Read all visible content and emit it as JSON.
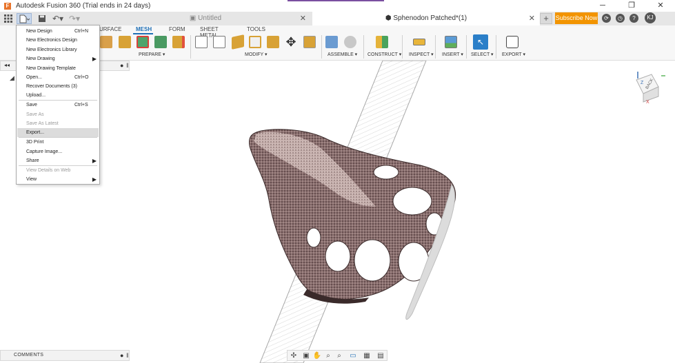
{
  "window": {
    "title": "Autodesk Fusion 360 (Trial ends in 24 days)",
    "minimize": "─",
    "maximize": "❐",
    "close": "✕"
  },
  "tabs": {
    "inactive": {
      "label": "Untitled",
      "close": "✕"
    },
    "active": {
      "label": "Sphenodon Patched*(1)",
      "close": "✕"
    },
    "new_tab": "+",
    "subscribe": "Subscribe Now",
    "user_initials": "KJ"
  },
  "ribbon": {
    "workspace_tabs": [
      "URFACE",
      "MESH",
      "FORM",
      "SHEET METAL",
      "TOOLS"
    ],
    "active_tab": "MESH",
    "groups": [
      "PREPARE ▾",
      "MODIFY ▾",
      "ASSEMBLE ▾",
      "CONSTRUCT ▾",
      "INSPECT ▾",
      "INSERT ▾",
      "SELECT ▾",
      "EXPORT ▾"
    ]
  },
  "file_menu": {
    "items": [
      {
        "label": "New Design",
        "shortcut": "Ctrl+N",
        "disabled": false,
        "submenu": false
      },
      {
        "label": "New Electronics Design",
        "shortcut": "",
        "disabled": false,
        "submenu": false
      },
      {
        "label": "New Electronics Library",
        "shortcut": "",
        "disabled": false,
        "submenu": false
      },
      {
        "label": "New Drawing",
        "shortcut": "",
        "disabled": false,
        "submenu": true
      },
      {
        "label": "New Drawing Template",
        "shortcut": "",
        "disabled": false,
        "submenu": false
      },
      {
        "label": "Open...",
        "shortcut": "Ctrl+O",
        "disabled": false,
        "submenu": false
      },
      {
        "label": "Recover Documents (3)",
        "shortcut": "",
        "disabled": false,
        "submenu": false
      },
      {
        "label": "Upload...",
        "shortcut": "",
        "disabled": false,
        "submenu": false
      },
      {
        "label": "Save",
        "shortcut": "Ctrl+S",
        "disabled": false,
        "submenu": false
      },
      {
        "label": "Save As",
        "shortcut": "",
        "disabled": true,
        "submenu": false
      },
      {
        "label": "Save As Latest",
        "shortcut": "",
        "disabled": true,
        "submenu": false
      },
      {
        "label": "Export...",
        "shortcut": "",
        "disabled": false,
        "submenu": false,
        "hover": true
      },
      {
        "label": "3D Print",
        "shortcut": "",
        "disabled": false,
        "submenu": false
      },
      {
        "label": "Capture Image...",
        "shortcut": "",
        "disabled": false,
        "submenu": false
      },
      {
        "label": "Share",
        "shortcut": "",
        "disabled": false,
        "submenu": true
      },
      {
        "label": "View Details on Web",
        "shortcut": "",
        "disabled": true,
        "submenu": false
      },
      {
        "label": "View",
        "shortcut": "",
        "disabled": false,
        "submenu": true
      }
    ]
  },
  "viewcube": {
    "face": "BACK",
    "axis_z": "Z",
    "axis_x": "X"
  },
  "comments": {
    "label": "COMMENTS"
  },
  "accent_colors": {
    "subscribe": "#f29400",
    "active_tab": "#1f6fb5",
    "mesh": "#8a6e6e"
  }
}
